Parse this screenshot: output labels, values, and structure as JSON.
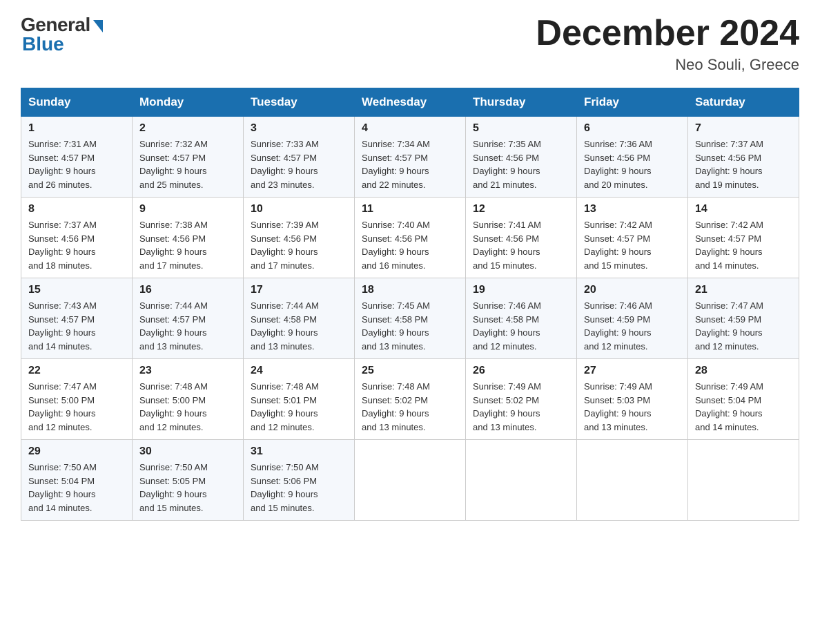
{
  "header": {
    "logo_general": "General",
    "logo_blue": "Blue",
    "month_year": "December 2024",
    "location": "Neo Souli, Greece"
  },
  "weekdays": [
    "Sunday",
    "Monday",
    "Tuesday",
    "Wednesday",
    "Thursday",
    "Friday",
    "Saturday"
  ],
  "weeks": [
    [
      {
        "day": "1",
        "sunrise": "7:31 AM",
        "sunset": "4:57 PM",
        "daylight": "9 hours and 26 minutes."
      },
      {
        "day": "2",
        "sunrise": "7:32 AM",
        "sunset": "4:57 PM",
        "daylight": "9 hours and 25 minutes."
      },
      {
        "day": "3",
        "sunrise": "7:33 AM",
        "sunset": "4:57 PM",
        "daylight": "9 hours and 23 minutes."
      },
      {
        "day": "4",
        "sunrise": "7:34 AM",
        "sunset": "4:57 PM",
        "daylight": "9 hours and 22 minutes."
      },
      {
        "day": "5",
        "sunrise": "7:35 AM",
        "sunset": "4:56 PM",
        "daylight": "9 hours and 21 minutes."
      },
      {
        "day": "6",
        "sunrise": "7:36 AM",
        "sunset": "4:56 PM",
        "daylight": "9 hours and 20 minutes."
      },
      {
        "day": "7",
        "sunrise": "7:37 AM",
        "sunset": "4:56 PM",
        "daylight": "9 hours and 19 minutes."
      }
    ],
    [
      {
        "day": "8",
        "sunrise": "7:37 AM",
        "sunset": "4:56 PM",
        "daylight": "9 hours and 18 minutes."
      },
      {
        "day": "9",
        "sunrise": "7:38 AM",
        "sunset": "4:56 PM",
        "daylight": "9 hours and 17 minutes."
      },
      {
        "day": "10",
        "sunrise": "7:39 AM",
        "sunset": "4:56 PM",
        "daylight": "9 hours and 17 minutes."
      },
      {
        "day": "11",
        "sunrise": "7:40 AM",
        "sunset": "4:56 PM",
        "daylight": "9 hours and 16 minutes."
      },
      {
        "day": "12",
        "sunrise": "7:41 AM",
        "sunset": "4:56 PM",
        "daylight": "9 hours and 15 minutes."
      },
      {
        "day": "13",
        "sunrise": "7:42 AM",
        "sunset": "4:57 PM",
        "daylight": "9 hours and 15 minutes."
      },
      {
        "day": "14",
        "sunrise": "7:42 AM",
        "sunset": "4:57 PM",
        "daylight": "9 hours and 14 minutes."
      }
    ],
    [
      {
        "day": "15",
        "sunrise": "7:43 AM",
        "sunset": "4:57 PM",
        "daylight": "9 hours and 14 minutes."
      },
      {
        "day": "16",
        "sunrise": "7:44 AM",
        "sunset": "4:57 PM",
        "daylight": "9 hours and 13 minutes."
      },
      {
        "day": "17",
        "sunrise": "7:44 AM",
        "sunset": "4:58 PM",
        "daylight": "9 hours and 13 minutes."
      },
      {
        "day": "18",
        "sunrise": "7:45 AM",
        "sunset": "4:58 PM",
        "daylight": "9 hours and 13 minutes."
      },
      {
        "day": "19",
        "sunrise": "7:46 AM",
        "sunset": "4:58 PM",
        "daylight": "9 hours and 12 minutes."
      },
      {
        "day": "20",
        "sunrise": "7:46 AM",
        "sunset": "4:59 PM",
        "daylight": "9 hours and 12 minutes."
      },
      {
        "day": "21",
        "sunrise": "7:47 AM",
        "sunset": "4:59 PM",
        "daylight": "9 hours and 12 minutes."
      }
    ],
    [
      {
        "day": "22",
        "sunrise": "7:47 AM",
        "sunset": "5:00 PM",
        "daylight": "9 hours and 12 minutes."
      },
      {
        "day": "23",
        "sunrise": "7:48 AM",
        "sunset": "5:00 PM",
        "daylight": "9 hours and 12 minutes."
      },
      {
        "day": "24",
        "sunrise": "7:48 AM",
        "sunset": "5:01 PM",
        "daylight": "9 hours and 12 minutes."
      },
      {
        "day": "25",
        "sunrise": "7:48 AM",
        "sunset": "5:02 PM",
        "daylight": "9 hours and 13 minutes."
      },
      {
        "day": "26",
        "sunrise": "7:49 AM",
        "sunset": "5:02 PM",
        "daylight": "9 hours and 13 minutes."
      },
      {
        "day": "27",
        "sunrise": "7:49 AM",
        "sunset": "5:03 PM",
        "daylight": "9 hours and 13 minutes."
      },
      {
        "day": "28",
        "sunrise": "7:49 AM",
        "sunset": "5:04 PM",
        "daylight": "9 hours and 14 minutes."
      }
    ],
    [
      {
        "day": "29",
        "sunrise": "7:50 AM",
        "sunset": "5:04 PM",
        "daylight": "9 hours and 14 minutes."
      },
      {
        "day": "30",
        "sunrise": "7:50 AM",
        "sunset": "5:05 PM",
        "daylight": "9 hours and 15 minutes."
      },
      {
        "day": "31",
        "sunrise": "7:50 AM",
        "sunset": "5:06 PM",
        "daylight": "9 hours and 15 minutes."
      },
      null,
      null,
      null,
      null
    ]
  ],
  "labels": {
    "sunrise": "Sunrise:",
    "sunset": "Sunset:",
    "daylight": "Daylight:"
  }
}
